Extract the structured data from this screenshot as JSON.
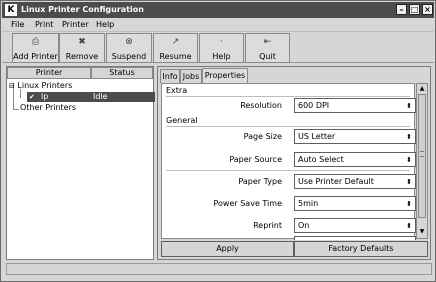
{
  "window": {
    "app_icon": "K",
    "title": "Linux Printer Configuration",
    "buttons": {
      "minimize": "–",
      "maximize": "□",
      "close": "×"
    }
  },
  "menu": {
    "items": [
      "File",
      "Print",
      "Printer",
      "Help"
    ]
  },
  "toolbar": {
    "items": [
      {
        "label": "Add Printer",
        "icon": "printer-add-icon",
        "glyph": "⎙"
      },
      {
        "label": "Remove",
        "icon": "remove-icon",
        "glyph": "✖"
      },
      {
        "label": "Suspend",
        "icon": "suspend-icon",
        "glyph": "⊗"
      },
      {
        "label": "Resume",
        "icon": "resume-icon",
        "glyph": "↗"
      },
      {
        "label": "Help",
        "icon": "help-icon",
        "glyph": "·"
      },
      {
        "label": "Quit",
        "icon": "quit-icon",
        "glyph": "⇤"
      }
    ]
  },
  "left_pane": {
    "columns": [
      "Printer",
      "Status"
    ],
    "tree": {
      "root": "Linux Printers",
      "printer_name": "lp",
      "printer_status": "Idle",
      "other": "Other Printers"
    }
  },
  "right_pane": {
    "tabs": [
      "Info",
      "Jobs",
      "Properties"
    ],
    "active_tab": "Properties",
    "groups": {
      "extra": "Extra",
      "general": "General"
    },
    "properties": [
      {
        "label": "Resolution",
        "value": "600 DPI"
      },
      {
        "label": "Page Size",
        "value": "US Letter"
      },
      {
        "label": "Paper Source",
        "value": "Auto Select"
      },
      {
        "label": "Paper Type",
        "value": "Use Printer Default"
      },
      {
        "label": "Power Save Time",
        "value": "5min"
      },
      {
        "label": "Reprint",
        "value": "On"
      }
    ],
    "buttons": {
      "apply": "Apply",
      "factory_defaults": "Factory Defaults"
    }
  },
  "colors": {
    "titlebar": "#4c4c4c",
    "selection": "#4c4c4c",
    "face": "#d6d6d6"
  }
}
